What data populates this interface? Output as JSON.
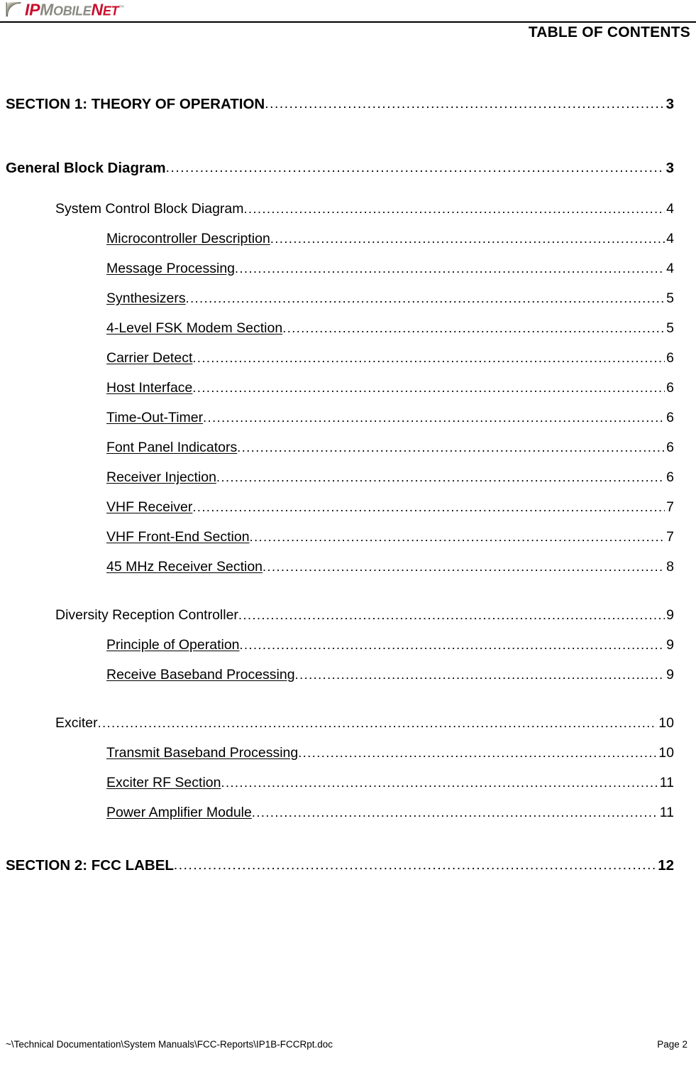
{
  "header": {
    "logo": {
      "icon": "ipmobilenet-swoosh-icon",
      "part1": "IP",
      "part2": "M",
      "part2_rest": "OBILE",
      "part3": "N",
      "part3_rest": "ET",
      "trademark": "™"
    },
    "title": "TABLE OF CONTENTS"
  },
  "toc": {
    "entries": [
      {
        "level": 1,
        "label": "SECTION 1: THEORY OF OPERATION",
        "page": "3"
      },
      {
        "level": 1,
        "label": "General Block Diagram",
        "page": "3"
      },
      {
        "level": 2,
        "label": "System Control Block Diagram",
        "page": "4"
      },
      {
        "level": 3,
        "label": "Microcontroller Description",
        "page": "4"
      },
      {
        "level": 3,
        "label": "Message Processing",
        "page": "4"
      },
      {
        "level": 3,
        "label": "Synthesizers",
        "page": "5"
      },
      {
        "level": 3,
        "label": "4-Level FSK Modem Section",
        "page": "5"
      },
      {
        "level": 3,
        "label": "Carrier Detect",
        "page": "6"
      },
      {
        "level": 3,
        "label": "Host Interface",
        "page": "6"
      },
      {
        "level": 3,
        "label": "Time-Out-Timer",
        "page": "6"
      },
      {
        "level": 3,
        "label": "Font Panel Indicators",
        "page": "6"
      },
      {
        "level": 3,
        "label": "Receiver Injection",
        "page": "6"
      },
      {
        "level": 3,
        "label": "VHF Receiver",
        "page": "7"
      },
      {
        "level": 3,
        "label": "VHF Front-End Section",
        "page": "7"
      },
      {
        "level": 3,
        "label": "45 MHz Receiver Section",
        "page": "8"
      },
      {
        "level": 2,
        "label": "Diversity Reception Controller",
        "page": "9"
      },
      {
        "level": 3,
        "label": "Principle of Operation",
        "page": "9"
      },
      {
        "level": 3,
        "label": "Receive Baseband Processing",
        "page": "9"
      },
      {
        "level": 2,
        "label": "Exciter",
        "page": "10"
      },
      {
        "level": 3,
        "label": "Transmit Baseband Processing",
        "page": "10"
      },
      {
        "level": 3,
        "label": "Exciter RF Section",
        "page": "11"
      },
      {
        "level": 3,
        "label": "Power Amplifier Module",
        "page": "11"
      },
      {
        "level": 1,
        "label": "SECTION 2: FCC LABEL",
        "page": "12"
      }
    ]
  },
  "footer": {
    "path": "~\\Technical Documentation\\System Manuals\\FCC-Reports\\IP1B-FCCRpt.doc",
    "page": "Page 2"
  },
  "colors": {
    "brand_red": "#c8102e",
    "brand_gray": "#8a8a82",
    "rule": "#000000"
  }
}
